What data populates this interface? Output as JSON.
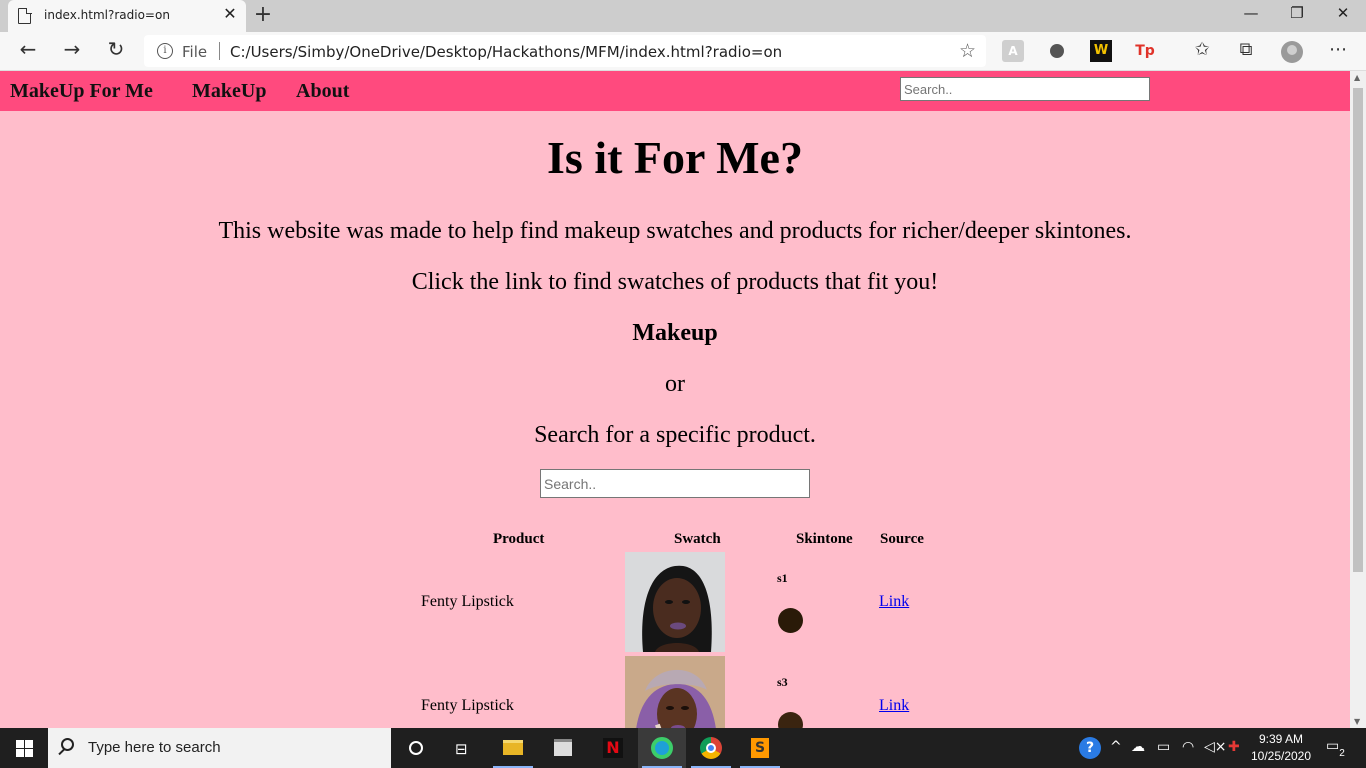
{
  "browser": {
    "tab_title": "index.html?radio=on",
    "address_scheme": "File",
    "address_url": "C:/Users/Simby/OneDrive/Desktop/Hackathons/MFM/index.html?radio=on"
  },
  "nav": {
    "brand": "MakeUp For Me",
    "makeup": "MakeUp",
    "about": "About",
    "search_placeholder": "Search.."
  },
  "main": {
    "title": "Is it For Me?",
    "intro": "This website was made to help find makeup swatches and products for richer/deeper skintones.",
    "cta": "Click the link to find swatches of products that fit you!",
    "makeup_link": "Makeup",
    "or": "or",
    "search_prompt": "Search for a specific product.",
    "search_placeholder": "Search.."
  },
  "table": {
    "headers": [
      "Product",
      "Swatch",
      "Skintone",
      "Source"
    ],
    "rows": [
      {
        "product": "Fenty Lipstick",
        "skintone": "s1",
        "skintone_color": "#2a1a08",
        "source": "Link"
      },
      {
        "product": "Fenty Lipstick",
        "skintone": "s3",
        "skintone_color": "#3a2410",
        "source": "Link"
      }
    ]
  },
  "taskbar": {
    "search_text": "Type here to search",
    "time": "9:39 AM",
    "date": "10/25/2020",
    "notifications": "2"
  },
  "colors": {
    "page_bg": "#ffbdcb",
    "nav_bg": "#ff4a7e",
    "link": "#0000ee"
  }
}
